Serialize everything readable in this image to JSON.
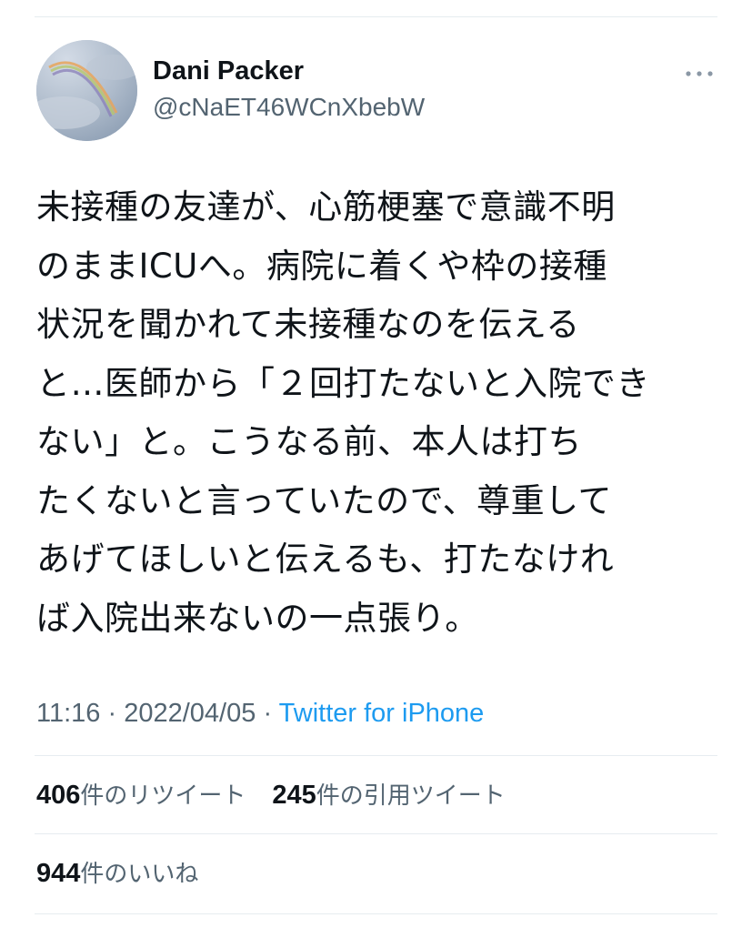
{
  "tweet": {
    "author": {
      "display_name": "Dani Packer",
      "handle": "@cNaET46WCnXbebW",
      "avatar_icon": "rainbow-sky-avatar"
    },
    "more_icon": "more-horizontal-icon",
    "text": "未接種の友達が、心筋梗塞で意識不明\nのままICUへ。病院に着くや枠の接種\n状況を聞かれて未接種なのを伝える\nと…医師から「２回打たないと入院でき\nない」と。こうなる前、本人は打ち\nたくないと言っていたので、尊重して\nあげてほしいと伝えるも、打たなけれ\nば入院出来ないの一点張り。",
    "time": "11:16",
    "date": "2022/04/05",
    "separator": "·",
    "source": "Twitter for iPhone",
    "retweets": {
      "count": "406",
      "label": "件のリツイート"
    },
    "quotes": {
      "count": "245",
      "label": "件の引用ツイート"
    },
    "likes": {
      "count": "944",
      "label": "件のいいね"
    }
  },
  "colors": {
    "text": "#0f1419",
    "secondary": "#536471",
    "link": "#1d9bf0",
    "divider": "#e6ecf0"
  }
}
